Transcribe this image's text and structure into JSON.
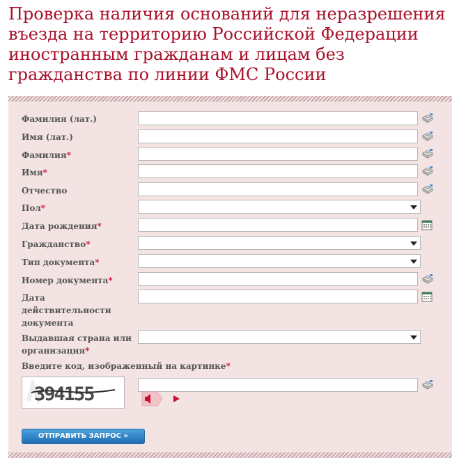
{
  "page": {
    "title": "Проверка наличия оснований для неразрешения въезда на территорию Российской Федерации иностранным гражданам и лицам без гражданства по линии ФМС России"
  },
  "form": {
    "fields": {
      "lastname_lat": {
        "label": "Фамилия (лат.)",
        "value": ""
      },
      "firstname_lat": {
        "label": "Имя (лат.)",
        "value": ""
      },
      "lastname": {
        "label": "Фамилия",
        "required_mark": "*",
        "value": ""
      },
      "firstname": {
        "label": "Имя",
        "required_mark": "*",
        "value": ""
      },
      "patronymic": {
        "label": "Отчество",
        "value": ""
      },
      "gender": {
        "label": "Пол",
        "required_mark": "*",
        "value": ""
      },
      "birthdate": {
        "label": "Дата рождения",
        "required_mark": "*",
        "value": ""
      },
      "citizenship": {
        "label": "Гражданство",
        "required_mark": "*",
        "value": ""
      },
      "doc_type": {
        "label": "Тип документа",
        "required_mark": "*",
        "value": ""
      },
      "doc_number": {
        "label": "Номер документа",
        "required_mark": "*",
        "value": ""
      },
      "doc_validity": {
        "label_line1": "Дата",
        "label_line2": "действительности",
        "label_line3": "документа",
        "value": ""
      },
      "issuer": {
        "label_line1": "Выдавшая страна или",
        "label_line2": "организация",
        "required_mark": "*",
        "value": ""
      },
      "captcha": {
        "label": "Введите код, изображенный на картинке",
        "required_mark": "*",
        "value": ""
      }
    },
    "captcha_image_text": "394155",
    "submit_label": "ОТПРАВИТЬ ЗАПРОС »"
  },
  "icons": {
    "keyboard": "virtual-keyboard-icon",
    "calendar": "calendar-icon",
    "audio": "audio-speaker-icon",
    "play": "play-icon"
  },
  "colors": {
    "title": "#a8102a",
    "panel_bg": "#f3e3e3",
    "required": "#cc1133",
    "button": "#1f6fb3"
  }
}
